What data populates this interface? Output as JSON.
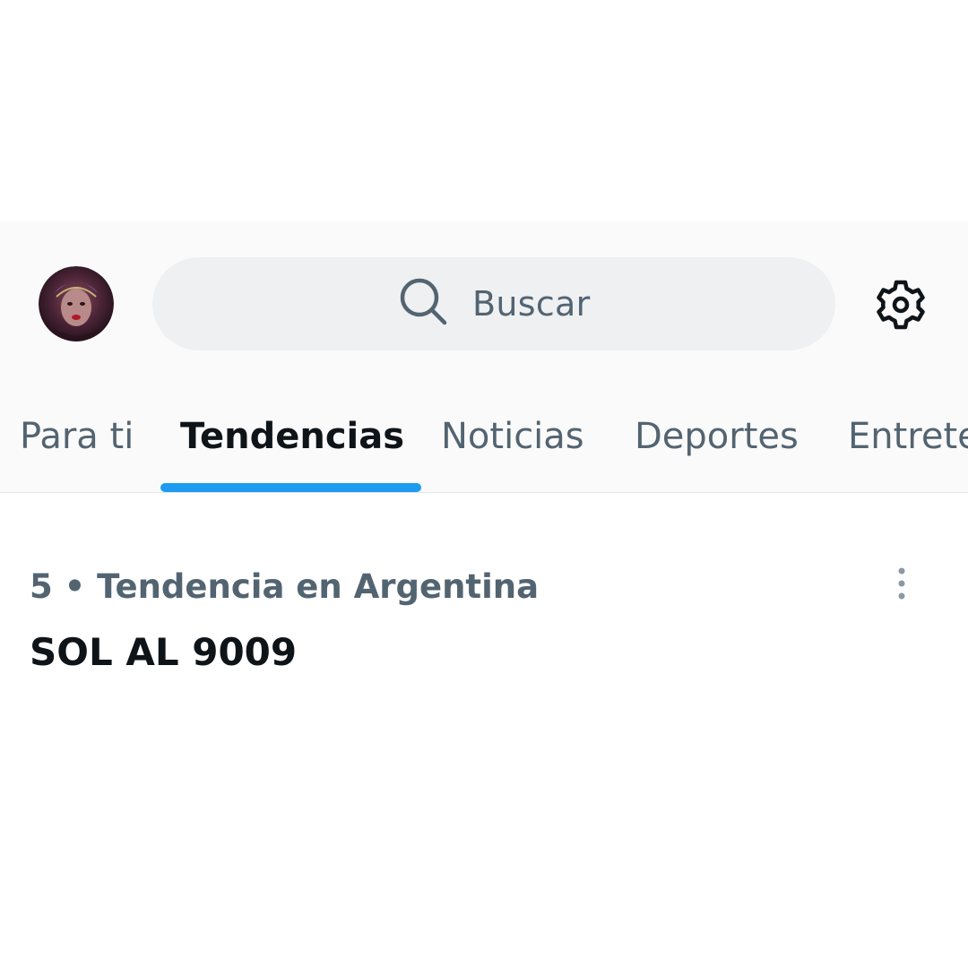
{
  "header": {
    "avatar_icon": "avatar-icon",
    "search": {
      "placeholder": "Buscar",
      "icon": "search-icon"
    },
    "settings_icon": "gear-icon"
  },
  "tabs": [
    {
      "label": "Para ti",
      "active": false
    },
    {
      "label": "Tendencias",
      "active": true
    },
    {
      "label": "Noticias",
      "active": false
    },
    {
      "label": "Deportes",
      "active": false
    },
    {
      "label": "Entretenimiento",
      "active": false
    }
  ],
  "trend": {
    "meta": "5 • Tendencia en Argentina",
    "title": "SOL AL 9009",
    "more_icon": "more-vertical-icon"
  },
  "colors": {
    "accent": "#1d9bf0",
    "text_primary": "#0f1419",
    "text_secondary": "#536471",
    "search_bg": "#eef0f2"
  }
}
